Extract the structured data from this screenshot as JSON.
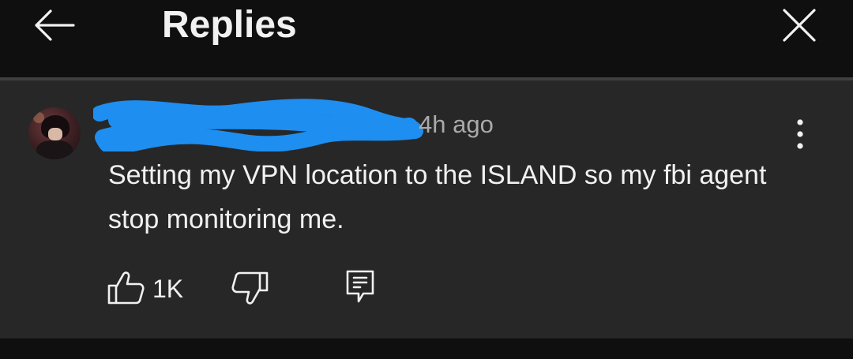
{
  "header": {
    "title": "Replies",
    "back_icon": "arrow-left-icon",
    "close_icon": "close-icon"
  },
  "comment": {
    "author_redaction": "blue-scribble",
    "timestamp": "4h ago",
    "text": "Setting my VPN location to the ISLAND so my fbi agent stop monitoring me.",
    "like_count": "1K",
    "menu_icon": "more-vertical-icon",
    "like_icon": "thumbs-up-icon",
    "dislike_icon": "thumbs-down-icon",
    "reply_icon": "reply-comment-icon"
  },
  "colors": {
    "background": "#0f0f0f",
    "comment_background": "#272727",
    "text": "#f1f1f1",
    "secondary_text": "#aaaaaa",
    "redaction": "#1e8ef0"
  }
}
